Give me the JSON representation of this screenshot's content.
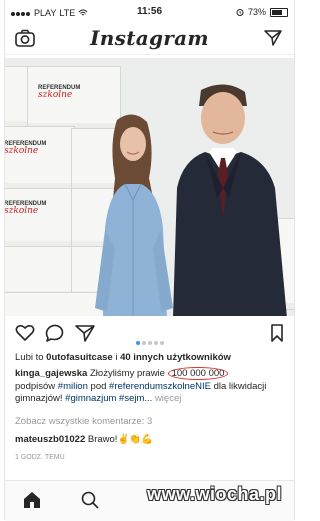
{
  "status_bar": {
    "carrier": "PLAY",
    "network": "LTE",
    "time": "11:56",
    "battery": "73%"
  },
  "header": {
    "title": "Instagram"
  },
  "photo": {
    "box_label_top": "REFERENDUM",
    "box_label_script": "szkolne"
  },
  "post": {
    "likes": {
      "prefix": "Lubi to ",
      "user": "0utofasuitcase",
      "middle": " i ",
      "others": "40 innych użytkowników"
    },
    "author": "kinga_gajewska",
    "caption_1": " Złożyliśmy prawie ",
    "circled_value": "100 000 000",
    "caption_2": "podpisów ",
    "tag_1": "#milion",
    "caption_3": " pod ",
    "tag_2": "#referendumszkolneNIE",
    "caption_4": " dla likwidacji gimnazjów! ",
    "tag_3": "#gimnazjum",
    "tag_4": "#sejm...",
    "more": "więcej",
    "view_comments": "Zobacz wszystkie komentarze: 3",
    "comment_user": "mateuszb01022",
    "comment_text": "Brawo!✌👏💪",
    "time_ago": "1 GODZ. TEMU"
  },
  "watermark": "www.wiocha.pl",
  "colors": {
    "link": "#003569",
    "accent": "#3897f0",
    "annotation": "#e03030"
  }
}
